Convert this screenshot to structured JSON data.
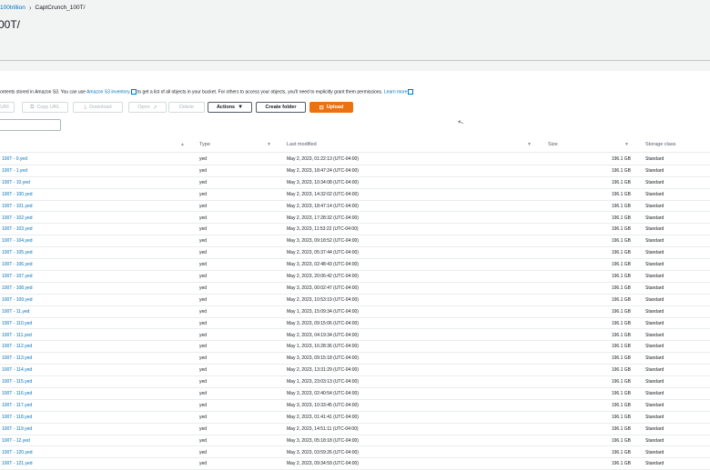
{
  "breadcrumb": {
    "parent": "100trillion",
    "separator": "›",
    "current": "CaptCrunch_100T/"
  },
  "page_title": "00T/",
  "info": {
    "text_1": "ontents stored in Amazon S3. You can use ",
    "inventory_link": "Amazon S3 inventory",
    "text_2": " to get a list of all objects in your bucket. For others to access your objects, you'll need to explicitly grant them permissions. ",
    "learn_more": "Learn more"
  },
  "toolbar": {
    "copy_s3_uri": "URI",
    "copy_url": "Copy URL",
    "download": "Download",
    "open": "Open",
    "delete": "Delete",
    "actions": "Actions",
    "create_folder": "Create folder",
    "upload": "Upload"
  },
  "search": {
    "value": ""
  },
  "table": {
    "headers": {
      "type": "Type",
      "last_modified": "Last modified",
      "size": "Size",
      "storage_class": "Storage class"
    },
    "rows": [
      {
        "name": "100T - 0.yed",
        "type": "yed",
        "modified": "May 2, 2023, 01:22:13 (UTC-04:00)",
        "size": "196.1 GB",
        "storage": "Standard"
      },
      {
        "name": "100T - 1.yed",
        "type": "yed",
        "modified": "May 2, 2023, 18:47:24 (UTC-04:00)",
        "size": "196.1 GB",
        "storage": "Standard"
      },
      {
        "name": "100T - 10.yed",
        "type": "yed",
        "modified": "May 3, 2023, 10:34:08 (UTC-04:00)",
        "size": "196.1 GB",
        "storage": "Standard"
      },
      {
        "name": "100T - 100.yed",
        "type": "yed",
        "modified": "May 2, 2023, 14:32:02 (UTC-04:00)",
        "size": "196.1 GB",
        "storage": "Standard"
      },
      {
        "name": "100T - 101.yed",
        "type": "yed",
        "modified": "May 2, 2023, 18:47:14 (UTC-04:00)",
        "size": "196.1 GB",
        "storage": "Standard"
      },
      {
        "name": "100T - 102.yed",
        "type": "yed",
        "modified": "May 2, 2023, 17:28:32 (UTC-04:00)",
        "size": "196.1 GB",
        "storage": "Standard"
      },
      {
        "name": "100T - 103.yed",
        "type": "yed",
        "modified": "May 3, 2023, 11:53:22 (UTC-04:00)",
        "size": "196.1 GB",
        "storage": "Standard"
      },
      {
        "name": "100T - 104.yed",
        "type": "yed",
        "modified": "May 3, 2023, 09:18:52 (UTC-04:00)",
        "size": "196.1 GB",
        "storage": "Standard"
      },
      {
        "name": "100T - 105.yed",
        "type": "yed",
        "modified": "May 2, 2023, 05:37:44 (UTC-04:00)",
        "size": "196.1 GB",
        "storage": "Standard"
      },
      {
        "name": "100T - 106.yed",
        "type": "yed",
        "modified": "May 3, 2023, 02:48:43 (UTC-04:00)",
        "size": "196.1 GB",
        "storage": "Standard"
      },
      {
        "name": "100T - 107.yed",
        "type": "yed",
        "modified": "May 2, 2023, 20:06:42 (UTC-04:00)",
        "size": "196.1 GB",
        "storage": "Standard"
      },
      {
        "name": "100T - 108.yed",
        "type": "yed",
        "modified": "May 3, 2023, 00:02:47 (UTC-04:00)",
        "size": "196.1 GB",
        "storage": "Standard"
      },
      {
        "name": "100T - 109.yed",
        "type": "yed",
        "modified": "May 2, 2023, 10:53:19 (UTC-04:00)",
        "size": "196.1 GB",
        "storage": "Standard"
      },
      {
        "name": "100T - 11.yed",
        "type": "yed",
        "modified": "May 1, 2023, 15:09:34 (UTC-04:00)",
        "size": "196.1 GB",
        "storage": "Standard"
      },
      {
        "name": "100T - 110.yed",
        "type": "yed",
        "modified": "May 3, 2023, 09:15:06 (UTC-04:00)",
        "size": "196.1 GB",
        "storage": "Standard"
      },
      {
        "name": "100T - 111.yed",
        "type": "yed",
        "modified": "May 2, 2023, 04:19:34 (UTC-04:00)",
        "size": "196.1 GB",
        "storage": "Standard"
      },
      {
        "name": "100T - 112.yed",
        "type": "yed",
        "modified": "May 1, 2023, 16:28:36 (UTC-04:00)",
        "size": "196.1 GB",
        "storage": "Standard"
      },
      {
        "name": "100T - 113.yed",
        "type": "yed",
        "modified": "May 3, 2023, 09:15:18 (UTC-04:00)",
        "size": "196.1 GB",
        "storage": "Standard"
      },
      {
        "name": "100T - 114.yed",
        "type": "yed",
        "modified": "May 2, 2023, 13:31:29 (UTC-04:00)",
        "size": "196.1 GB",
        "storage": "Standard"
      },
      {
        "name": "100T - 115.yed",
        "type": "yed",
        "modified": "May 1, 2023, 23:03:13 (UTC-04:00)",
        "size": "196.1 GB",
        "storage": "Standard"
      },
      {
        "name": "100T - 116.yed",
        "type": "yed",
        "modified": "May 3, 2023, 02:40:54 (UTC-04:00)",
        "size": "196.1 GB",
        "storage": "Standard"
      },
      {
        "name": "100T - 117.yed",
        "type": "yed",
        "modified": "May 3, 2023, 10:33:45 (UTC-04:00)",
        "size": "196.1 GB",
        "storage": "Standard"
      },
      {
        "name": "100T - 118.yed",
        "type": "yed",
        "modified": "May 2, 2023, 01:41:41 (UTC-04:00)",
        "size": "196.1 GB",
        "storage": "Standard"
      },
      {
        "name": "100T - 119.yed",
        "type": "yed",
        "modified": "May 2, 2023, 14:51:11 (UTC-04:00)",
        "size": "196.1 GB",
        "storage": "Standard"
      },
      {
        "name": "100T - 12.yed",
        "type": "yed",
        "modified": "May 3, 2023, 05:18:18 (UTC-04:00)",
        "size": "196.1 GB",
        "storage": "Standard"
      },
      {
        "name": "100T - 120.yed",
        "type": "yed",
        "modified": "May 3, 2023, 03:59:26 (UTC-04:00)",
        "size": "196.1 GB",
        "storage": "Standard"
      },
      {
        "name": "100T - 121.yed",
        "type": "yed",
        "modified": "May 2, 2023, 09:34:59 (UTC-04:00)",
        "size": "196.1 GB",
        "storage": "Standard"
      }
    ]
  },
  "colors": {
    "link": "#0073bb",
    "primary": "#ec7211",
    "background": "#f2f3f3"
  }
}
